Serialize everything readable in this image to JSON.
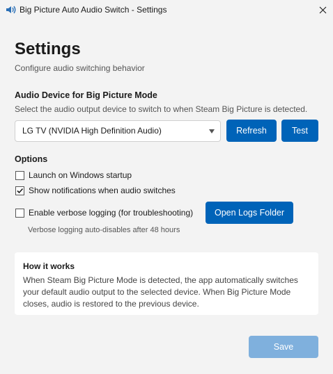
{
  "window": {
    "title": "Big Picture Auto Audio Switch - Settings"
  },
  "header": {
    "title": "Settings",
    "subtitle": "Configure audio switching behavior"
  },
  "audio_device": {
    "title": "Audio Device for Big Picture Mode",
    "description": "Select the audio output device to switch to when Steam Big Picture is detected.",
    "selected": "LG TV (NVIDIA High Definition Audio)",
    "refresh_label": "Refresh",
    "test_label": "Test"
  },
  "options": {
    "title": "Options",
    "launch_startup": {
      "label": "Launch on Windows startup",
      "checked": false
    },
    "show_notifications": {
      "label": "Show notifications when audio switches",
      "checked": true
    },
    "verbose_logging": {
      "label": "Enable verbose logging (for troubleshooting)",
      "checked": false
    },
    "open_logs_label": "Open Logs Folder",
    "verbose_hint": "Verbose logging auto-disables after 48 hours"
  },
  "how_it_works": {
    "title": "How it works",
    "body": "When Steam Big Picture Mode is detected, the app automatically switches your default audio output to the selected device. When Big Picture Mode closes, audio is restored to the previous device."
  },
  "footer": {
    "save_label": "Save"
  },
  "colors": {
    "accent": "#0063b8",
    "accent_disabled": "#7fb0dd"
  }
}
